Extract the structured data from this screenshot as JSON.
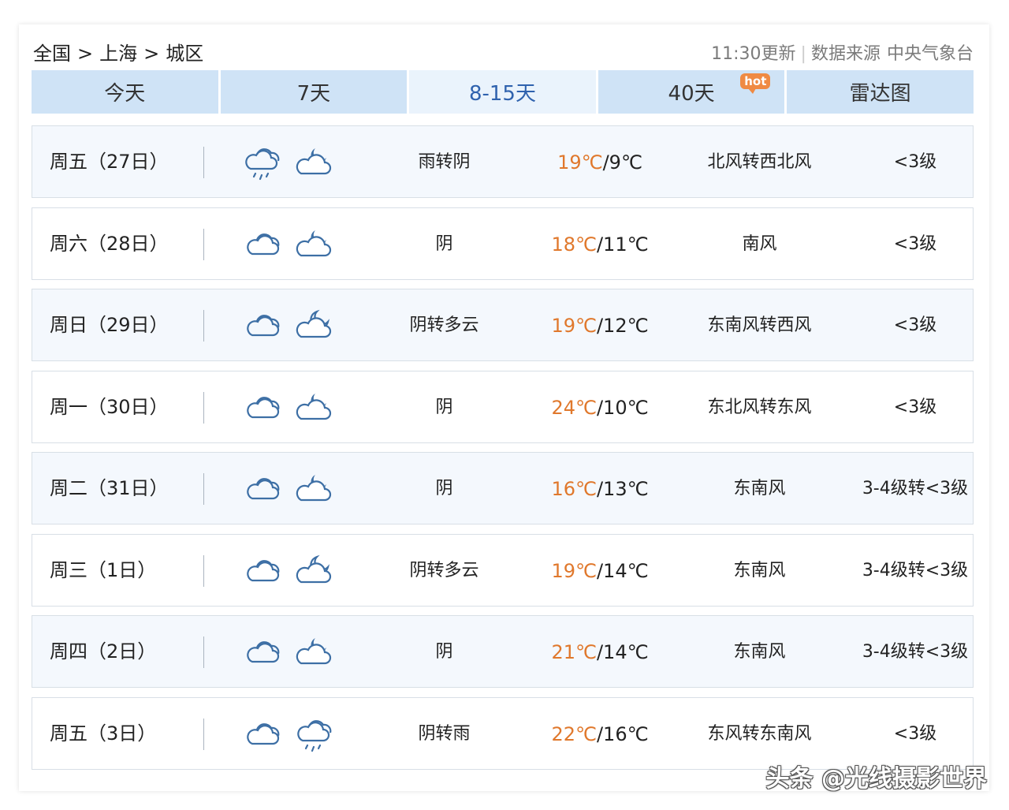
{
  "breadcrumb": [
    "全国",
    "上海",
    "城区"
  ],
  "breadcrumb_sep": ">",
  "update_time": "11:30更新",
  "source_label": "数据来源",
  "source_name": "中央气象台",
  "tabs": [
    {
      "label": "今天"
    },
    {
      "label": "7天"
    },
    {
      "label": "8-15天",
      "active": true
    },
    {
      "label": "40天",
      "badge": "hot"
    },
    {
      "label": "雷达图"
    }
  ],
  "days": [
    {
      "day": "周五（27日）",
      "icon_day": "rain-cloud-icon",
      "icon_night": "cloud-moon-icon",
      "condition": "雨转阴",
      "high": "19℃",
      "low": "9℃",
      "wind": "北风转西北风",
      "level": "<3级"
    },
    {
      "day": "周六（28日）",
      "icon_day": "overcast-cloud-icon",
      "icon_night": "cloud-moon-icon",
      "condition": "阴",
      "high": "18℃",
      "low": "11℃",
      "wind": "南风",
      "level": "<3级"
    },
    {
      "day": "周日（29日）",
      "icon_day": "overcast-cloud-icon",
      "icon_night": "moon-behind-cloud-icon",
      "condition": "阴转多云",
      "high": "19℃",
      "low": "12℃",
      "wind": "东南风转西风",
      "level": "<3级"
    },
    {
      "day": "周一（30日）",
      "icon_day": "overcast-cloud-icon",
      "icon_night": "cloud-moon-icon",
      "condition": "阴",
      "high": "24℃",
      "low": "10℃",
      "wind": "东北风转东风",
      "level": "<3级"
    },
    {
      "day": "周二（31日）",
      "icon_day": "overcast-cloud-icon",
      "icon_night": "cloud-moon-icon",
      "condition": "阴",
      "high": "16℃",
      "low": "13℃",
      "wind": "东南风",
      "level": "3-4级转<3级"
    },
    {
      "day": "周三（1日）",
      "icon_day": "overcast-cloud-icon",
      "icon_night": "moon-behind-cloud-icon",
      "condition": "阴转多云",
      "high": "19℃",
      "low": "14℃",
      "wind": "东南风",
      "level": "3-4级转<3级"
    },
    {
      "day": "周四（2日）",
      "icon_day": "overcast-cloud-icon",
      "icon_night": "cloud-moon-icon",
      "condition": "阴",
      "high": "21℃",
      "low": "14℃",
      "wind": "东南风",
      "level": "3-4级转<3级"
    },
    {
      "day": "周五（3日）",
      "icon_day": "overcast-cloud-icon",
      "icon_night": "rain-cloud-icon",
      "condition": "阴转雨",
      "high": "22℃",
      "low": "16℃",
      "wind": "东风转东南风",
      "level": "<3级"
    }
  ],
  "colors": {
    "tab_bg": "#cfe3f6",
    "tab_active_text": "#2f62ae",
    "high_temp": "#e0782c",
    "icon_stroke": "#3d6fa5"
  },
  "watermark": "头条 @光线摄影世界"
}
